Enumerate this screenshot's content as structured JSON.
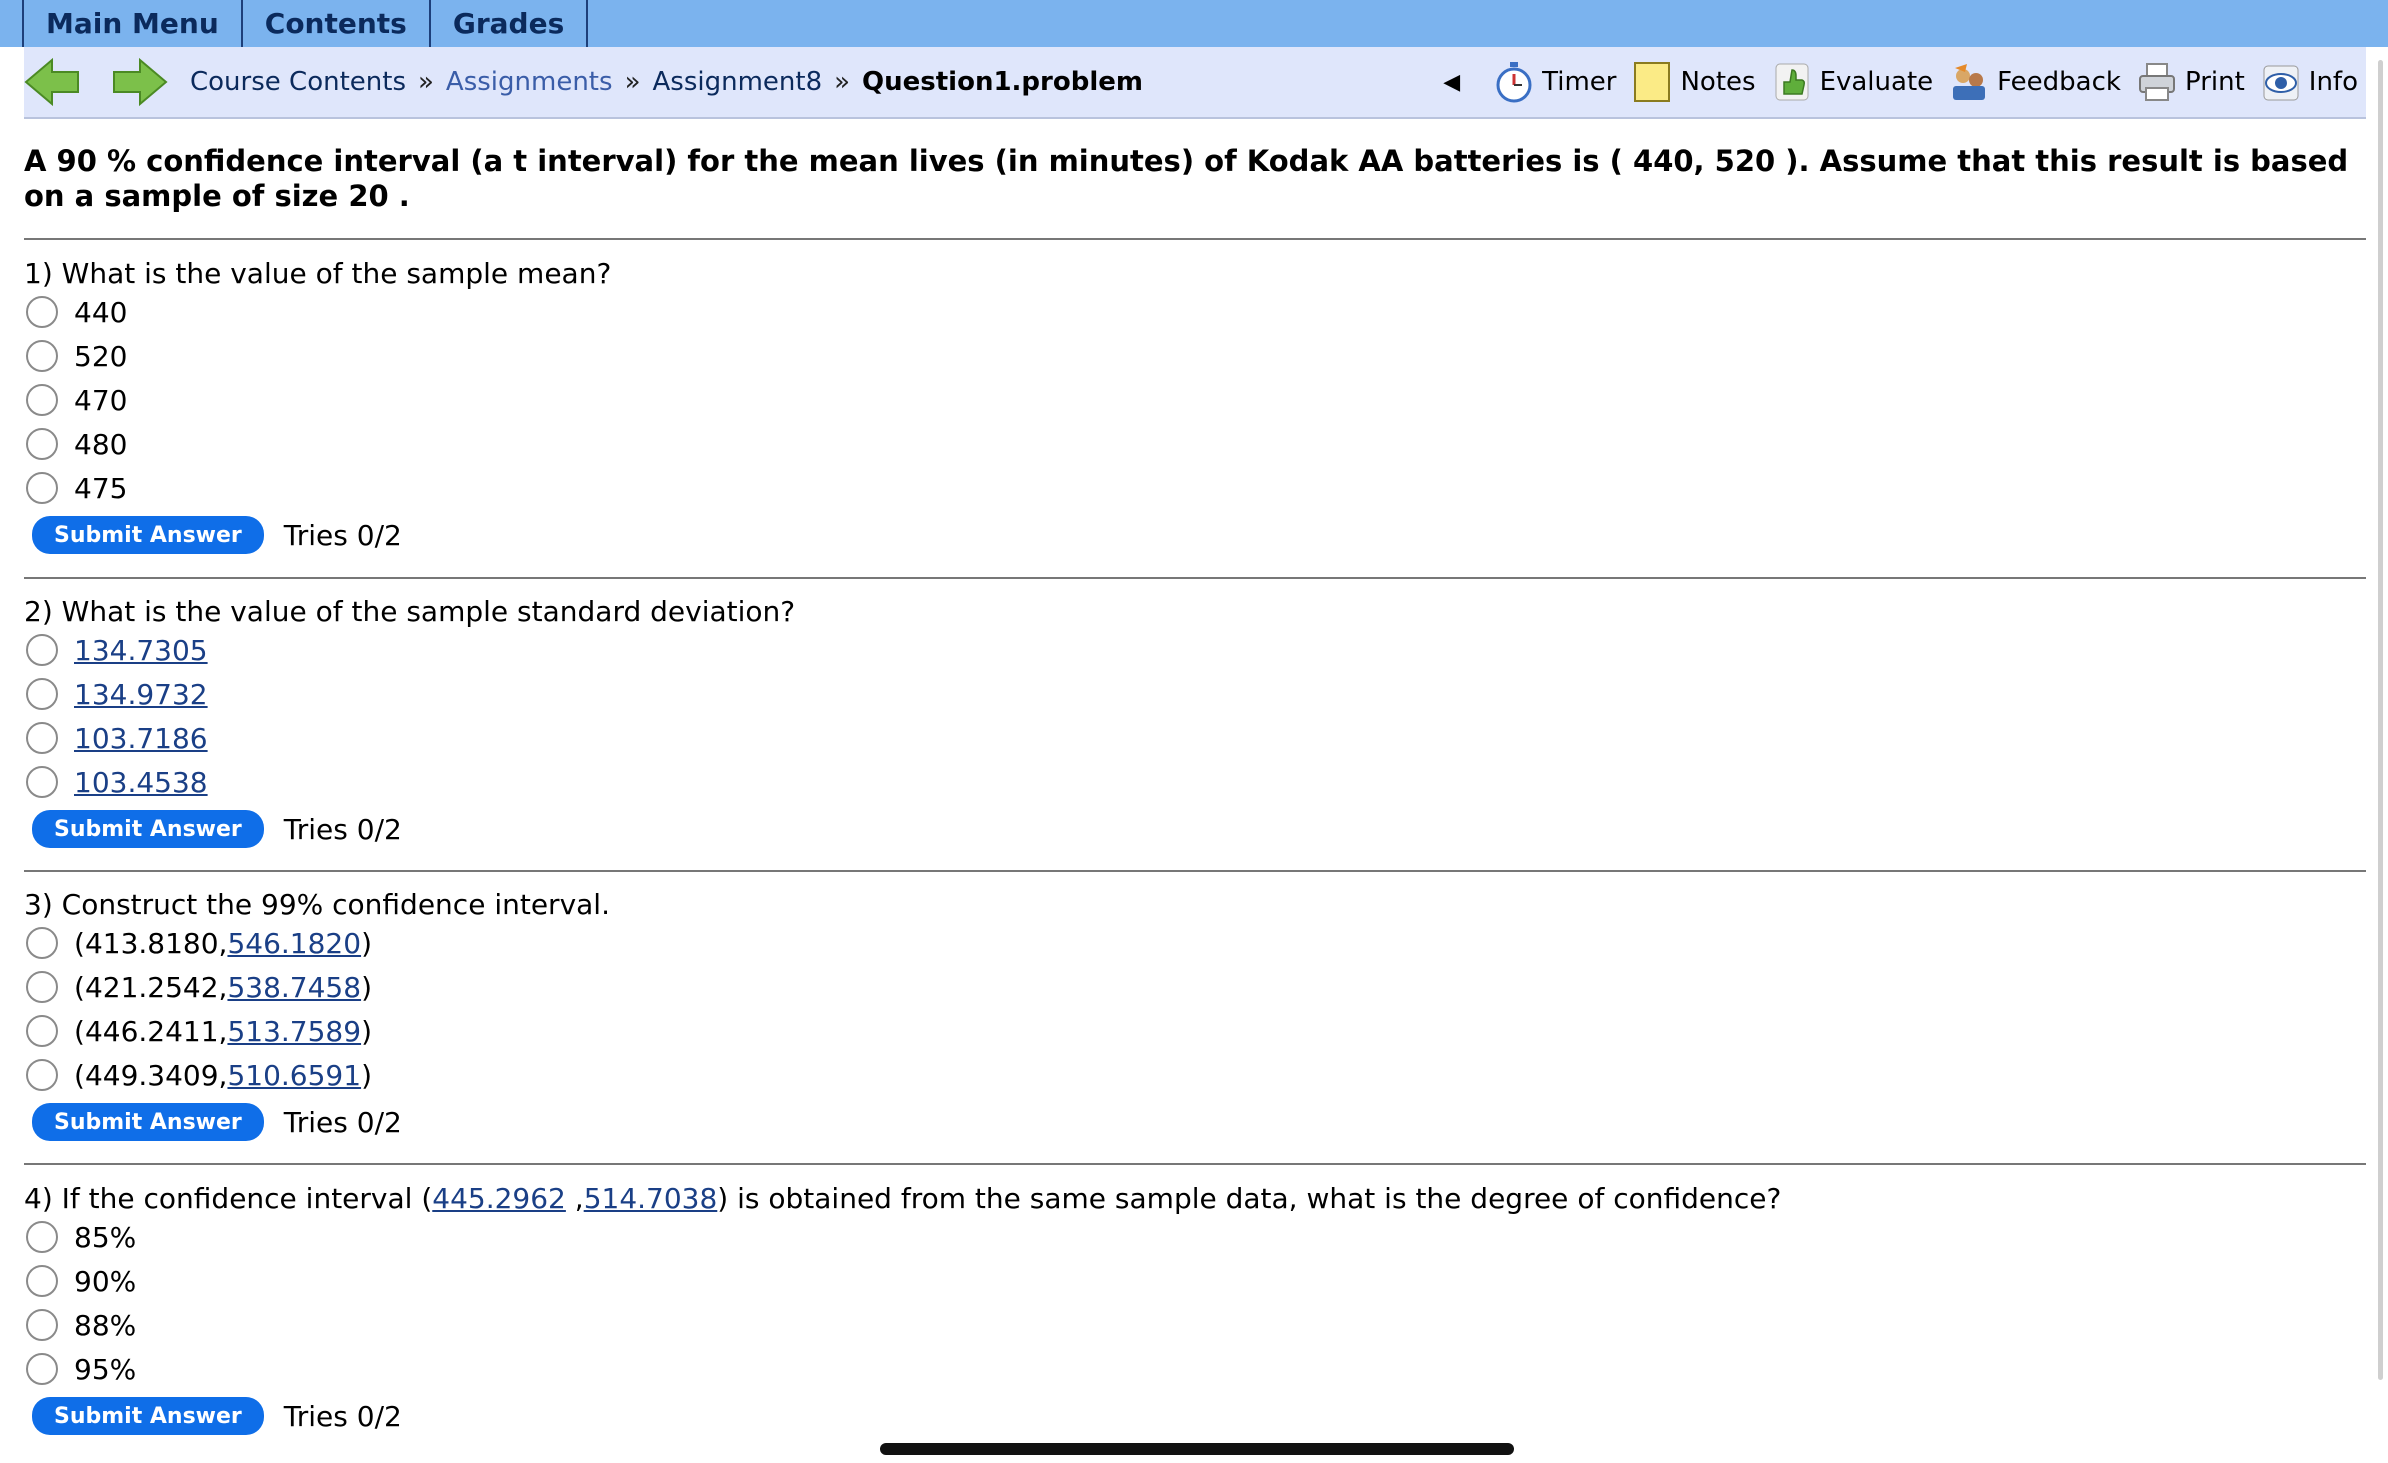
{
  "tabs": [
    "Main Menu",
    "Contents",
    "Grades"
  ],
  "breadcrumb": {
    "items": [
      "Course Contents",
      "Assignments",
      "Assignment8"
    ],
    "separator": "»",
    "current": "Question1.problem"
  },
  "toolbar": {
    "collapse_glyph": "◀",
    "timer": "Timer",
    "notes": "Notes",
    "evaluate": "Evaluate",
    "feedback": "Feedback",
    "print": "Print",
    "info": "Info"
  },
  "icons": {
    "back": "back-arrow-icon",
    "forward": "forward-arrow-icon",
    "timer": "stopwatch-icon",
    "notes": "note-icon",
    "evaluate": "thumbs-up-icon",
    "feedback": "feedback-icon",
    "print": "printer-icon",
    "info": "info-eye-icon"
  },
  "colors": {
    "tabbar": "#7bb3ee",
    "navbar": "#dfe6fb",
    "submit": "#0f6ee8",
    "link": "#1a3f86"
  },
  "intro": "A 90 % confidence interval (a t interval) for the mean lives (in minutes) of Kodak AA batteries is ( 440, 520 ). Assume that this result is based on a sample of size 20 .",
  "questions": [
    {
      "text": "1) What is the value of the sample mean?",
      "options": [
        "440",
        "520",
        "470",
        "480",
        "475"
      ],
      "submit": "Submit Answer",
      "tries": "Tries 0/2"
    },
    {
      "text": "2) What is the value of the sample standard deviation?",
      "options": [
        "134.7305",
        "134.9732",
        "103.7186",
        "103.4538"
      ],
      "submit": "Submit Answer",
      "tries": "Tries 0/2"
    },
    {
      "text": "3) Construct the 99% confidence interval.",
      "options": [
        {
          "open": "(",
          "lower": "413.8180",
          "comma": ",",
          "upper": "546.1820",
          "close": ")"
        },
        {
          "open": "(",
          "lower": "421.2542",
          "comma": ",",
          "upper": "538.7458",
          "close": ")"
        },
        {
          "open": "(",
          "lower": "446.2411",
          "comma": ",",
          "upper": "513.7589",
          "close": ")"
        },
        {
          "open": "(",
          "lower": "449.3409",
          "comma": ",",
          "upper": "510.6591",
          "close": ")"
        }
      ],
      "submit": "Submit Answer",
      "tries": "Tries 0/2"
    },
    {
      "text_before": "4) If the confidence interval (",
      "lower": "445.2962",
      "middle": " ,",
      "upper": "514.7038",
      "text_after": ") is obtained from the same sample data, what is the degree of confidence?",
      "options": [
        "85%",
        "90%",
        "88%",
        "95%"
      ],
      "submit": "Submit Answer",
      "tries": "Tries 0/2"
    }
  ]
}
